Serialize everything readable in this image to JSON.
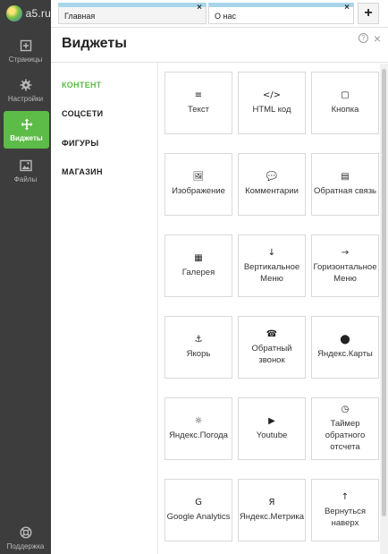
{
  "app": {
    "logo_text": "a5.ru"
  },
  "tabs": [
    {
      "label": "Главная"
    },
    {
      "label": "О нас"
    }
  ],
  "tab_add_label": "+",
  "tab_close_glyph": "×",
  "rail": {
    "items": [
      {
        "label": "Страницы",
        "icon": "plus-square-icon"
      },
      {
        "label": "Настройки",
        "icon": "gear-icon"
      },
      {
        "label": "Виджеты",
        "icon": "move-arrows-icon"
      },
      {
        "label": "Файлы",
        "icon": "image-icon"
      }
    ],
    "support": {
      "label": "Поддержка",
      "icon": "lifebuoy-icon"
    },
    "active_color": "#5dbb47"
  },
  "panel": {
    "title": "Виджеты",
    "help_glyph": "?",
    "close_glyph": "×",
    "categories": [
      "КОНТЕНТ",
      "СОЦСЕТИ",
      "ФИГУРЫ",
      "МАГАЗИН"
    ],
    "widgets": [
      {
        "label": "Текст",
        "icon": "≡"
      },
      {
        "label": "HTML код",
        "icon": "</>"
      },
      {
        "label": "Кнопка",
        "icon": "▢"
      },
      {
        "label": "Изображение",
        "icon": "🖼"
      },
      {
        "label": "Комментарии",
        "icon": "💬"
      },
      {
        "label": "Обратная связь",
        "icon": "▤"
      },
      {
        "label": "Галерея",
        "icon": "▦"
      },
      {
        "label": "Вертикальное Меню",
        "icon": "↓"
      },
      {
        "label": "Горизонтальное Меню",
        "icon": "→"
      },
      {
        "label": "Якорь",
        "icon": "⚓"
      },
      {
        "label": "Обратный звонок",
        "icon": "☎"
      },
      {
        "label": "Яндекс.Карты",
        "icon": "⬤"
      },
      {
        "label": "Яндекс.Погода",
        "icon": "☼"
      },
      {
        "label": "Youtube",
        "icon": "▶"
      },
      {
        "label": "Таймер обратного отсчета",
        "icon": "◷"
      },
      {
        "label": "Google Analytics",
        "icon": "G"
      },
      {
        "label": "Яндекс.Метрика",
        "icon": "Я"
      },
      {
        "label": "Вернуться наверх",
        "icon": "↑"
      }
    ]
  }
}
